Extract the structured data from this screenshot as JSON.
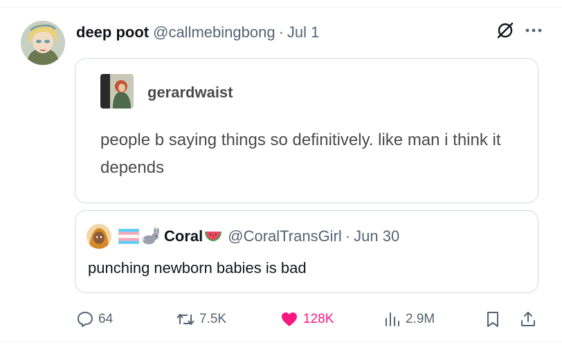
{
  "post": {
    "display_name": "deep poot",
    "handle": "@callmebingbong",
    "separator": "·",
    "date": "Jul 1"
  },
  "header_icons": [
    "grok-icon",
    "more-icon"
  ],
  "tumblr_quote": {
    "username": "gerardwaist",
    "text": "people b saying things so definitively. like man i think it depends"
  },
  "quoted_tweet": {
    "emoji_prefix": [
      "trans-flag-icon",
      "rabbit-icon"
    ],
    "display_name": "Coral",
    "emoji_suffix": "watermelon-icon",
    "handle": "@CoralTransGirl",
    "separator": "·",
    "date": "Jun 30",
    "text": "punching newborn babies is bad"
  },
  "actions": {
    "replies": "64",
    "reposts": "7.5K",
    "likes": "128K",
    "views": "2.9M"
  },
  "colors": {
    "text_primary": "#0f1419",
    "text_secondary": "#536471",
    "like_pink": "#f91880",
    "border": "#cfd9de"
  }
}
